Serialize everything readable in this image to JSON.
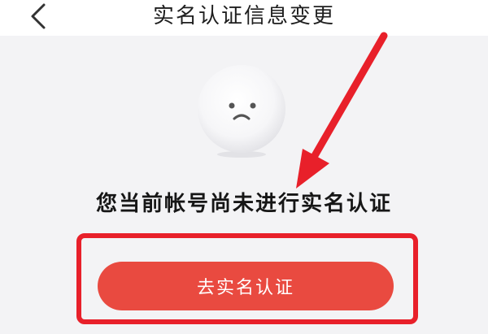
{
  "header": {
    "title": "实名认证信息变更",
    "back_icon": "chevron-left-icon"
  },
  "main": {
    "message": "您当前帐号尚未进行实名认证",
    "button_label": "去实名认证",
    "illustration_icon": "sad-face-icon"
  },
  "colors": {
    "accent": "#e94a40",
    "annotation": "#e8202a"
  }
}
